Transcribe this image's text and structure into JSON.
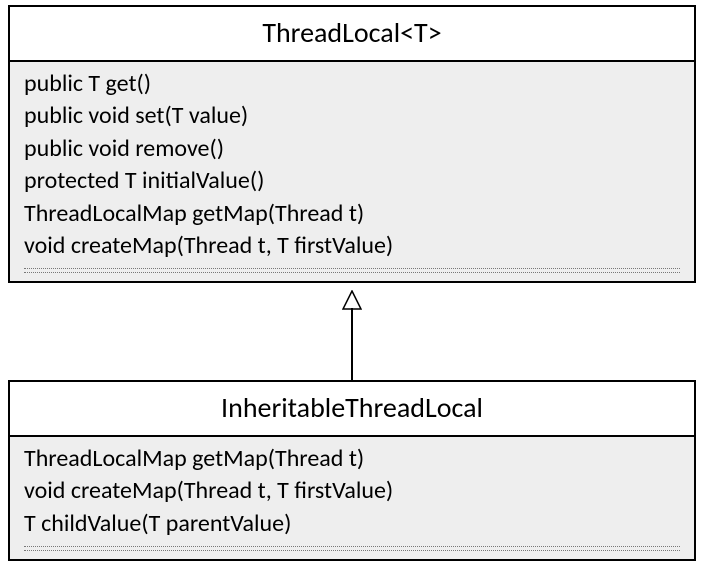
{
  "parent_class": {
    "title": "ThreadLocal<T>",
    "methods": [
      "public T get()",
      "public void set(T value)",
      "public void remove()",
      "protected T initialValue()",
      "ThreadLocalMap getMap(Thread t)",
      "void createMap(Thread t, T firstValue)"
    ]
  },
  "child_class": {
    "title": "InheritableThreadLocal",
    "methods": [
      "ThreadLocalMap getMap(Thread t)",
      "void createMap(Thread t, T firstValue)",
      "T childValue(T parentValue)"
    ]
  }
}
